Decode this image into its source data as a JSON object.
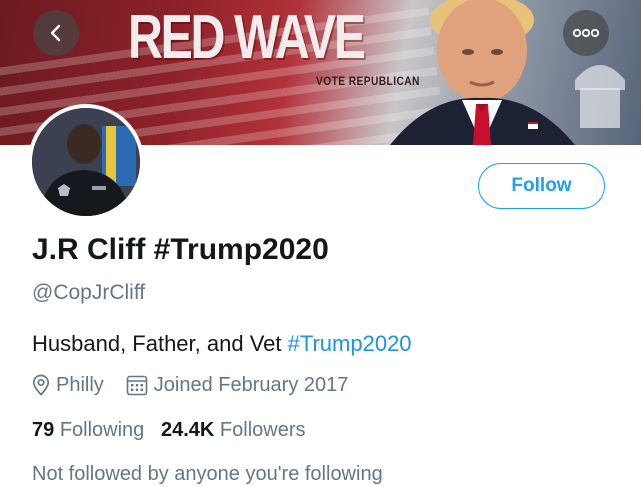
{
  "banner": {
    "title": "RED WAVE",
    "subtitle": "VOTE REPUBLICAN"
  },
  "icons": {
    "back": "back-arrow-icon",
    "more": "more-options-icon",
    "location": "location-pin-icon",
    "calendar": "calendar-icon"
  },
  "profile": {
    "follow_label": "Follow",
    "display_name": "J.R Cliff #Trump2020",
    "handle": "@CopJrCliff",
    "bio_text": "Husband, Father, and Vet ",
    "bio_hashtag": "#Trump2020",
    "location": "Philly",
    "joined": "Joined February 2017",
    "following_count": "79",
    "following_label": "Following",
    "followers_count": "24.4K",
    "followers_label": "Followers",
    "followed_by_partial": "Not followed by anyone you're following"
  },
  "colors": {
    "accent": "#1da1f2",
    "muted": "#657786",
    "text": "#14171a"
  }
}
